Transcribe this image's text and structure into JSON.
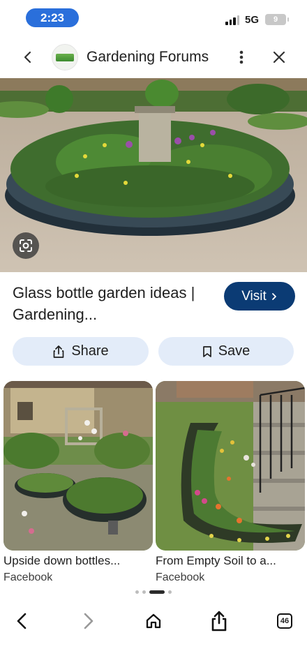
{
  "status_bar": {
    "time": "2:23",
    "network": "5G",
    "battery": "9"
  },
  "header": {
    "title": "Gardening Forums",
    "back_icon": "chevron-left-icon",
    "more_icon": "vertical-dots-icon",
    "close_icon": "close-icon"
  },
  "hero": {
    "lens_icon": "google-lens-icon"
  },
  "result": {
    "title": "Glass bottle garden ideas | Gardening...",
    "visit_label": "Visit",
    "share_label": "Share",
    "save_label": "Save"
  },
  "related": [
    {
      "title": "Upside down bottles...",
      "source": "Facebook"
    },
    {
      "title": "From Empty Soil to a...",
      "source": "Facebook"
    }
  ],
  "bottom_nav": {
    "back_icon": "chevron-left-icon",
    "forward_icon": "chevron-right-icon",
    "home_icon": "home-icon",
    "share_icon": "share-icon",
    "tab_count": "46"
  },
  "colors": {
    "time_pill": "#2a6fdb",
    "visit_button": "#0b3b74",
    "action_button": "#e3ecf9"
  }
}
